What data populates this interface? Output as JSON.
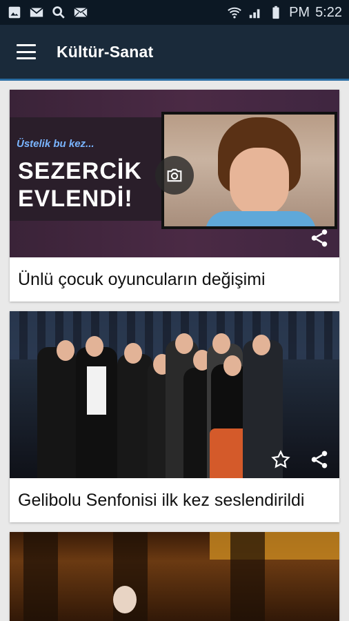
{
  "status_bar": {
    "left_icons": [
      "image-icon",
      "gmail-icon",
      "search-icon",
      "mail-icon"
    ],
    "right_icons": [
      "wifi-icon",
      "signal-icon",
      "battery-icon"
    ],
    "ampm": "PM",
    "time": "5:22"
  },
  "app_bar": {
    "title": "Kültür-Sanat",
    "menu_icon": "hamburger-menu-icon"
  },
  "cards": [
    {
      "image_pretitle": "Üstelik bu kez...",
      "image_headline_line1": "SEZERCİK",
      "image_headline_line2": "EVLENDİ!",
      "badge_icon": "camera-icon",
      "action_icons": [
        "share-icon"
      ],
      "title": "Ünlü çocuk oyuncuların değişimi"
    },
    {
      "action_icons": [
        "star-icon",
        "share-icon"
      ],
      "title": "Gelibolu Senfonisi ilk kez seslendirildi"
    },
    {
      "title": ""
    }
  ],
  "colors": {
    "status_bar_bg": "#0c1824",
    "app_bar_bg": "#1a2a3a",
    "app_bar_accent": "#2a6da3",
    "page_bg": "#e9e9e9"
  }
}
